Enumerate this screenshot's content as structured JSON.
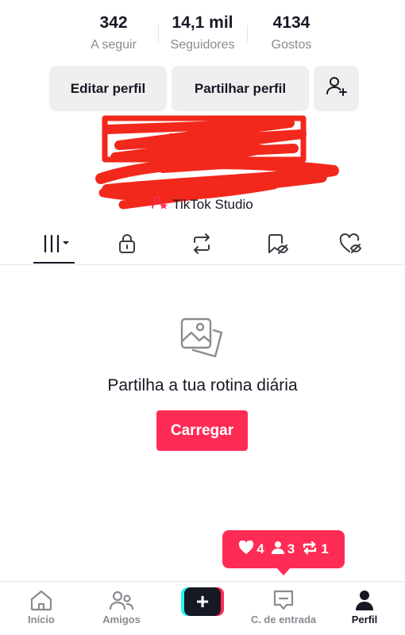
{
  "stats": [
    {
      "value": "342",
      "label": "A seguir"
    },
    {
      "value": "14,1 mil",
      "label": "Seguidores"
    },
    {
      "value": "4134",
      "label": "Gostos"
    }
  ],
  "actions": {
    "edit_label": "Editar perfil",
    "share_label": "Partilhar perfil",
    "add_friend_icon": "add-user-icon"
  },
  "studio": {
    "label": "TikTok Studio",
    "icon": "tiktok-studio-icon"
  },
  "tabs": [
    {
      "icon": "videos-grid-icon",
      "active": true
    },
    {
      "icon": "lock-icon",
      "active": false
    },
    {
      "icon": "repost-icon",
      "active": false
    },
    {
      "icon": "bookmark-hidden-icon",
      "active": false
    },
    {
      "icon": "liked-hidden-icon",
      "active": false
    }
  ],
  "empty_state": {
    "icon": "photos-icon",
    "title": "Partilha a tua rotina diária",
    "button_label": "Carregar"
  },
  "notifications": {
    "likes": "4",
    "followers": "3",
    "reposts": "1"
  },
  "nav": {
    "home": "Início",
    "friends": "Amigos",
    "create_icon": "plus-icon",
    "inbox": "C. de entrada",
    "profile": "Perfil"
  },
  "colors": {
    "accent": "#fe2c55",
    "cyan": "#25f4ee",
    "text": "#161823",
    "muted": "#8a8b91",
    "button_bg": "#efeff0"
  }
}
